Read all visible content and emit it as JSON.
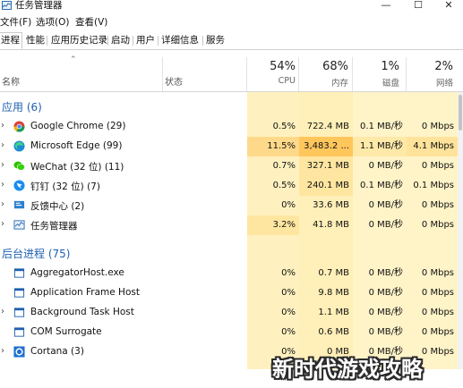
{
  "window": {
    "title": "任务管理器",
    "minimize_glyph": "—",
    "maximize_glyph": "☐",
    "close_glyph": "✕"
  },
  "menu": [
    "文件(F)",
    "选项(O)",
    "查看(V)"
  ],
  "tabs": [
    "进程",
    "性能",
    "应用历史记录",
    "启动",
    "用户",
    "详细信息",
    "服务"
  ],
  "active_tab": 0,
  "columns": {
    "name": "名称",
    "status": "状态",
    "cpu": {
      "pct": "54%",
      "label": "CPU"
    },
    "memory": {
      "pct": "68%",
      "label": "内存"
    },
    "disk": {
      "pct": "1%",
      "label": "磁盘"
    },
    "network": {
      "pct": "2%",
      "label": "网络"
    }
  },
  "sections": {
    "apps": "应用 (6)",
    "background": "后台进程 (75)"
  },
  "apps": [
    {
      "name": "Google Chrome (29)",
      "icon": "chrome-icon",
      "cpu": "0.5%",
      "mem": "722.4 MB",
      "disk": "0.1 MB/秒",
      "net": "0 Mbps",
      "expand": "›"
    },
    {
      "name": "Microsoft Edge (99)",
      "icon": "edge-icon",
      "cpu": "11.5%",
      "mem": "3,483.2 ...",
      "disk": "1.1 MB/秒",
      "net": "4.1 Mbps",
      "expand": "›"
    },
    {
      "name": "WeChat (32 位) (11)",
      "icon": "wechat-icon",
      "cpu": "0.7%",
      "mem": "327.1 MB",
      "disk": "0 MB/秒",
      "net": "0 Mbps",
      "expand": "›"
    },
    {
      "name": "钉钉 (32 位) (7)",
      "icon": "dingtalk-icon",
      "cpu": "0.5%",
      "mem": "240.1 MB",
      "disk": "0.1 MB/秒",
      "net": "0.1 Mbps",
      "expand": "›"
    },
    {
      "name": "反馈中心 (2)",
      "icon": "feedback-hub-icon",
      "cpu": "0%",
      "mem": "33.6 MB",
      "disk": "0 MB/秒",
      "net": "0 Mbps",
      "expand": "›"
    },
    {
      "name": "任务管理器",
      "icon": "task-manager-icon",
      "cpu": "3.2%",
      "mem": "41.8 MB",
      "disk": "0 MB/秒",
      "net": "0 Mbps",
      "expand": "›"
    }
  ],
  "background": [
    {
      "name": "AggregatorHost.exe",
      "icon": "window-icon",
      "cpu": "0%",
      "mem": "0.7 MB",
      "disk": "0 MB/秒",
      "net": "0 Mbps",
      "expand": ""
    },
    {
      "name": "Application Frame Host",
      "icon": "window-icon",
      "cpu": "0%",
      "mem": "9.8 MB",
      "disk": "0 MB/秒",
      "net": "0 Mbps",
      "expand": ""
    },
    {
      "name": "Background Task Host",
      "icon": "window-icon",
      "cpu": "0%",
      "mem": "1.1 MB",
      "disk": "0 MB/秒",
      "net": "0 Mbps",
      "expand": "›"
    },
    {
      "name": "COM Surrogate",
      "icon": "window-icon",
      "cpu": "0%",
      "mem": "0.6 MB",
      "disk": "0 MB/秒",
      "net": "0 Mbps",
      "expand": ""
    },
    {
      "name": "Cortana (3)",
      "icon": "cortana-icon",
      "cpu": "0%",
      "mem": "0 MB",
      "disk": "0 MB/秒",
      "net": "0 Mbps",
      "expand": "›"
    }
  ],
  "colors": {
    "heat_light": "#fff4c4",
    "heat_mid": "#ffe8a0",
    "heat_strong": "#ffd27a",
    "section_blue": "#1f5fb0"
  },
  "watermark": "新时代游戏攻略"
}
